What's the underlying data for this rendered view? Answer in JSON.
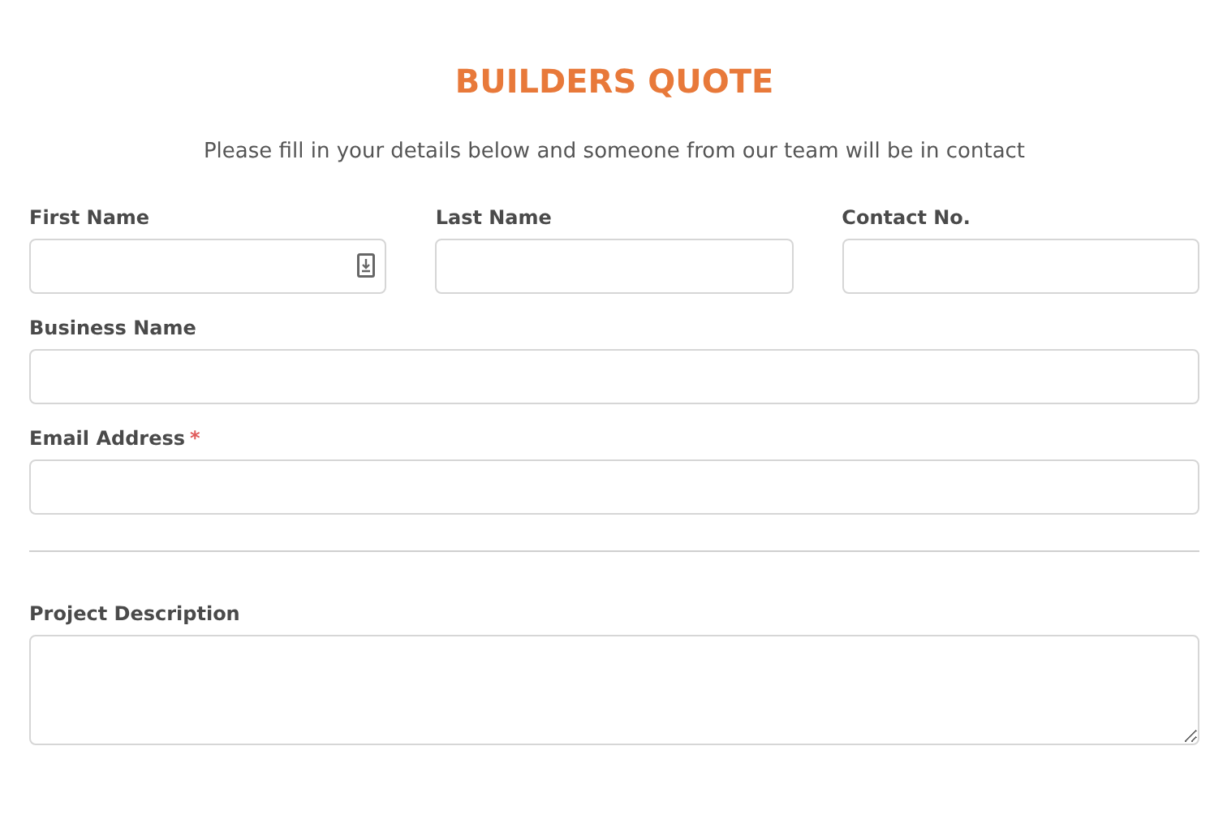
{
  "title": "BUILDERS QUOTE",
  "subtitle": "Please fill in your details below and someone from our team will be in contact",
  "rows": [
    {
      "kind": "fields",
      "fields": [
        {
          "label": "First Name",
          "kind": "text",
          "autofill_icon": true
        },
        {
          "label": "Last Name",
          "kind": "text"
        },
        {
          "label": "Contact No.",
          "kind": "text"
        }
      ]
    },
    {
      "kind": "fields",
      "fields": [
        {
          "label": "Business Name",
          "kind": "text"
        }
      ]
    },
    {
      "kind": "fields",
      "fields": [
        {
          "label": "Email Address",
          "kind": "text",
          "required_mark": "*"
        }
      ]
    },
    {
      "kind": "divider"
    },
    {
      "kind": "fields",
      "fields": [
        {
          "label": "Project Description",
          "kind": "textarea"
        }
      ]
    }
  ]
}
